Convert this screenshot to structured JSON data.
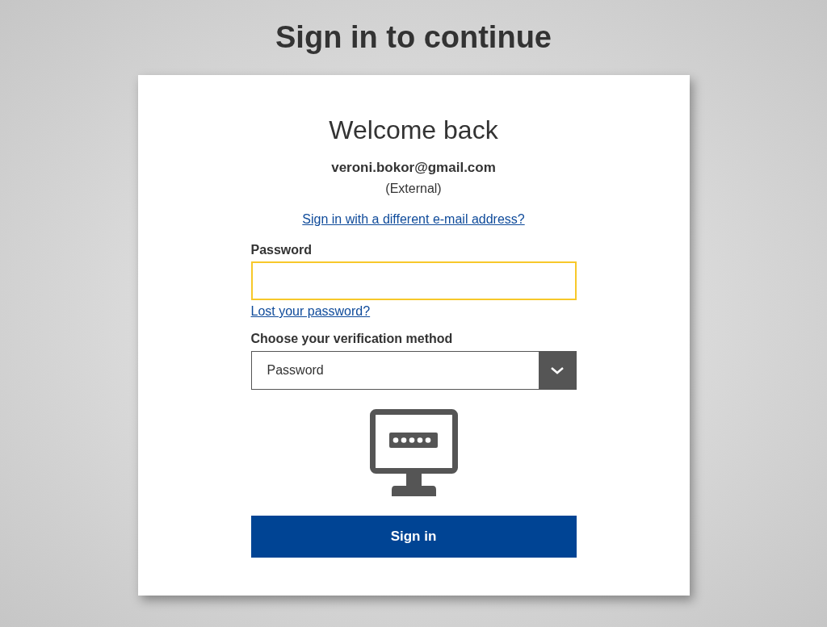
{
  "page_title": "Sign in to continue",
  "card": {
    "heading": "Welcome back",
    "email": "veroni.bokor@gmail.com",
    "account_type": "(External)",
    "switch_link": "Sign in with a different e-mail address?",
    "password": {
      "label": "Password",
      "focused": true
    },
    "lost_password_link": "Lost your password?",
    "method": {
      "label": "Choose your verification method",
      "value": "Password"
    },
    "submit": "Sign in"
  }
}
